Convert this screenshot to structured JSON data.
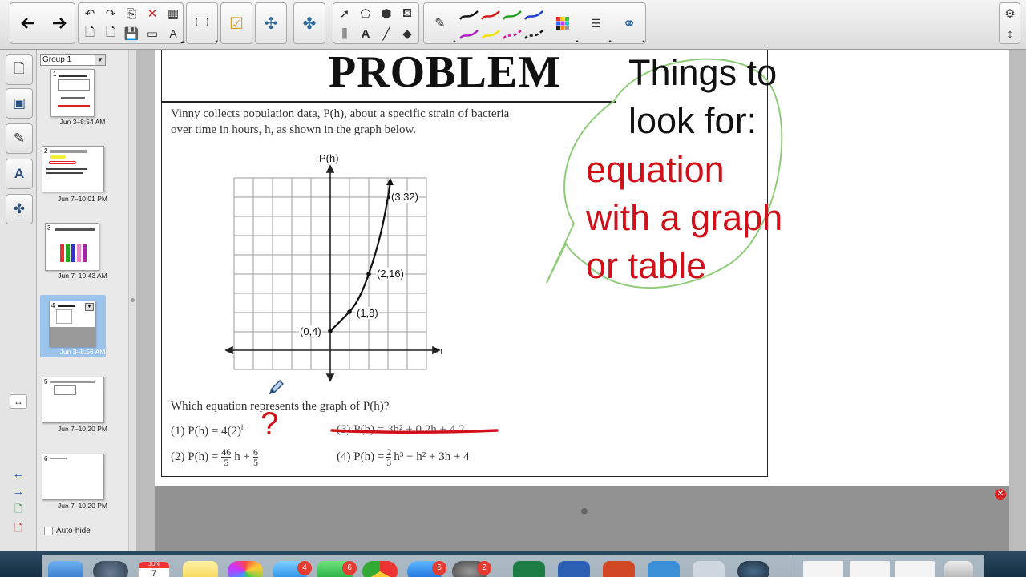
{
  "sidebar": {
    "group_label": "Group 1",
    "pages": [
      {
        "number": "1",
        "time": "Jun 3–8:54 AM"
      },
      {
        "number": "2",
        "time": "Jun 7–10:01 PM"
      },
      {
        "number": "3",
        "time": "Jun 7–10:43 AM"
      },
      {
        "number": "4",
        "time": "Jun 3–8:56 AM",
        "selected": true
      },
      {
        "number": "5",
        "time": "Jun 7–10:20 PM"
      },
      {
        "number": "6",
        "time": "Jun 7–10:20 PM"
      }
    ],
    "autohide_label": "Auto-hide"
  },
  "worksheet": {
    "title": "PROBLEM",
    "intro_line1": "Vinny collects population data, P(h), about a specific strain of bacteria",
    "intro_line2": "over time in hours, h, as shown in the graph below.",
    "question": "Which equation represents the graph of P(h)?",
    "choice1": "(1) P(h) = 4(2)",
    "choice1_exp": "h",
    "choice2_prefix": "(2) P(h) =",
    "choice2_frac1_num": "46",
    "choice2_frac1_den": "5",
    "choice2_mid": "h +",
    "choice2_frac2_num": "6",
    "choice2_frac2_den": "5",
    "choice3": "(3) P(h) = 3h² + 0.2h + 4.2",
    "choice4_prefix": "(4) P(h) =",
    "choice4_frac_num": "2",
    "choice4_frac_den": "3",
    "choice4_rest": "h³ − h² + 3h + 4"
  },
  "graph": {
    "y_axis_label": "P(h)",
    "x_axis_label": "h",
    "points": [
      {
        "label": "(0,4)"
      },
      {
        "label": "(1,8)"
      },
      {
        "label": "(2,16)"
      },
      {
        "label": "(3,32)"
      }
    ]
  },
  "annotations": {
    "callout_line1": "Things to",
    "callout_line2": "look for:",
    "red_line1": "equation",
    "red_line2": "with a graph",
    "red_line3": "or table",
    "question_mark": "?"
  },
  "dock": {
    "calendar_month": "JUN",
    "calendar_day": "7",
    "badges": [
      "4",
      "6",
      "6",
      "2"
    ]
  },
  "colors": {
    "accent_red": "#d1111a",
    "callout_green": "#8fcc7a",
    "selected_thumb": "#9cc3ec"
  }
}
